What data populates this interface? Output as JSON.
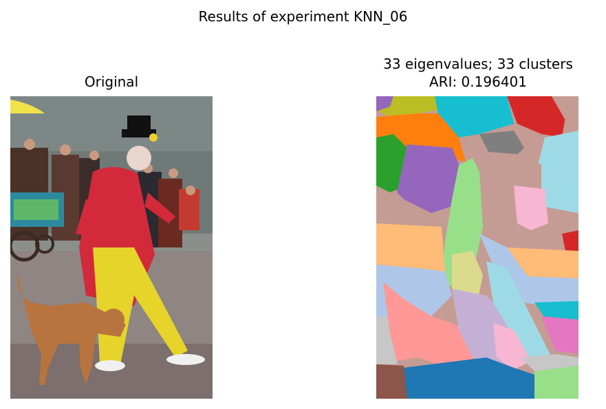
{
  "figure": {
    "suptitle": "Results of experiment KNN_06"
  },
  "left_panel": {
    "title": "Original"
  },
  "right_panel": {
    "title_line1": "33 eigenvalues; 33 clusters",
    "title_line2": "ARI: 0.196401"
  }
}
